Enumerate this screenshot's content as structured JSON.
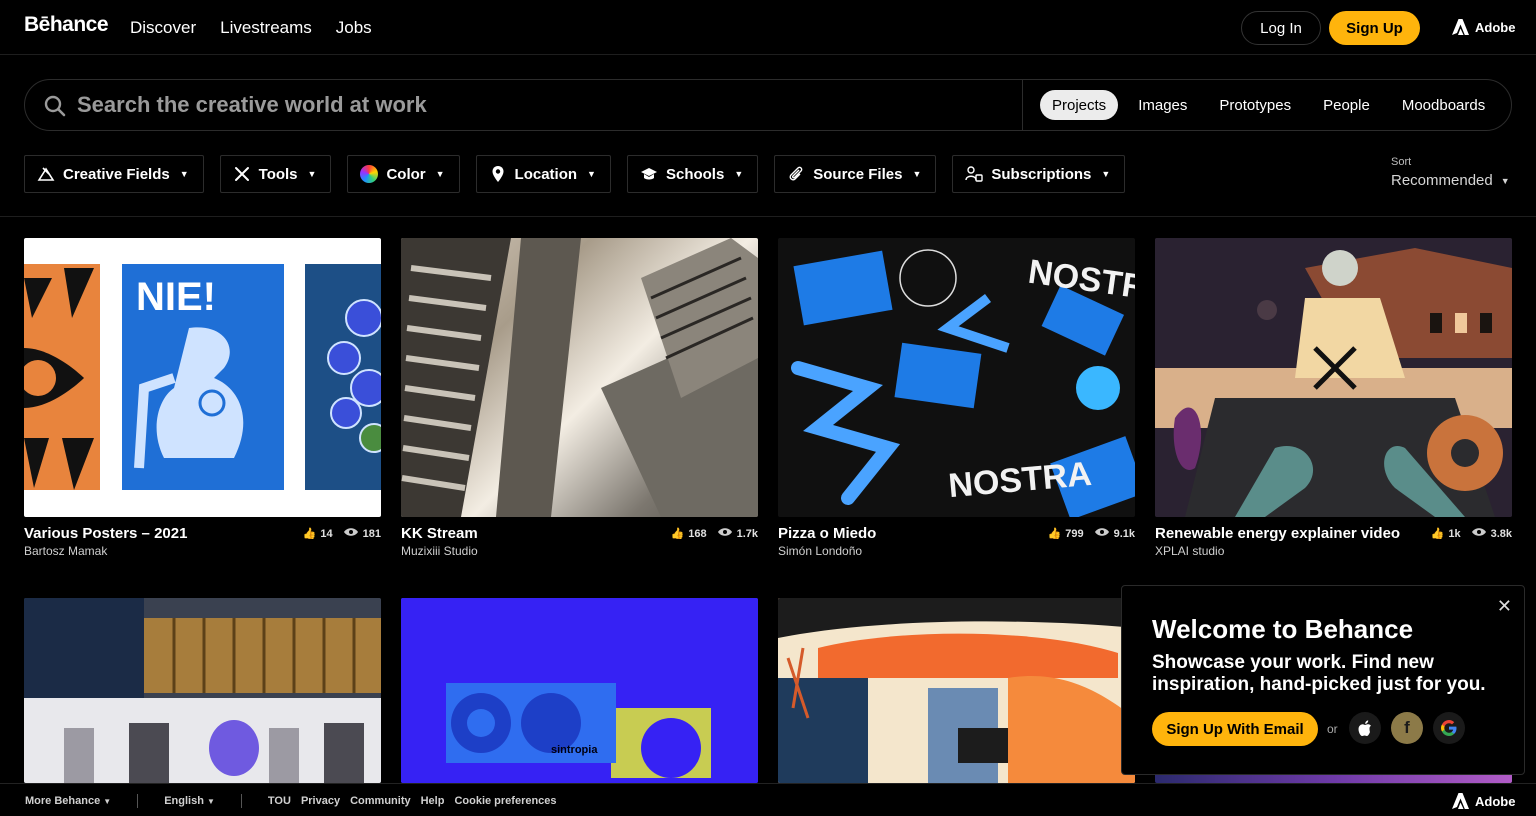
{
  "header": {
    "logo": "Bēhance",
    "nav": [
      "Discover",
      "Livestreams",
      "Jobs"
    ],
    "login": "Log In",
    "signup": "Sign Up",
    "adobe": "Adobe"
  },
  "search": {
    "placeholder": "Search the creative world at work",
    "tabs": [
      "Projects",
      "Images",
      "Prototypes",
      "People",
      "Moodboards"
    ],
    "active_tab": "Projects"
  },
  "filters": {
    "items": [
      "Creative Fields",
      "Tools",
      "Color",
      "Location",
      "Schools",
      "Source Files",
      "Subscriptions"
    ],
    "sort_label": "Sort",
    "sort_value": "Recommended"
  },
  "projects": [
    {
      "title": "Various Posters – 2021",
      "owner": "Bartosz Mamak",
      "likes": "14",
      "views": "181"
    },
    {
      "title": "KK Stream",
      "owner": "Muzixiii Studio",
      "likes": "168",
      "views": "1.7k"
    },
    {
      "title": "Pizza o Miedo",
      "owner": "Simón Londoño",
      "likes": "799",
      "views": "9.1k"
    },
    {
      "title": "Renewable energy explainer video",
      "owner": "XPLAI studio",
      "likes": "1k",
      "views": "3.8k"
    }
  ],
  "artwork_text": {
    "nie": "NIE!",
    "nostra": "NOSTRA",
    "sintropia": "sintropia"
  },
  "welcome": {
    "title": "Welcome to Behance",
    "text": "Showcase your work. Find new inspiration, hand-picked just for you.",
    "signup": "Sign Up With Email",
    "or": "or"
  },
  "footer": {
    "more": "More Behance",
    "language": "English",
    "links": [
      "TOU",
      "Privacy",
      "Community",
      "Help",
      "Cookie preferences"
    ],
    "adobe": "Adobe"
  },
  "colors": {
    "accent": "#ffb40c",
    "background": "#000000",
    "border": "#2c2c2c"
  }
}
